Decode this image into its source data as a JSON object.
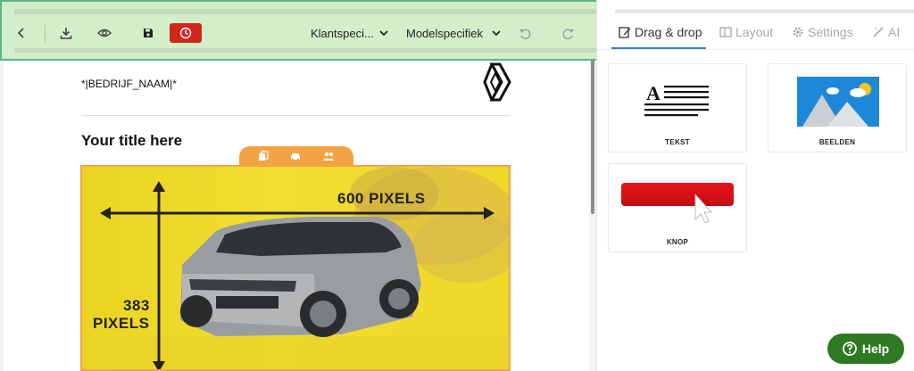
{
  "toolbar": {
    "dropdown_1": "Klantspeci...",
    "dropdown_2": "Modelspecifiek"
  },
  "email": {
    "company_name": "*|BEDRIJF_NAAM|*",
    "title": "Your title here",
    "hero": {
      "width_label": "600 PIXELS",
      "height_label_1": "383",
      "height_label_2": "PIXELS"
    }
  },
  "panel": {
    "tabs": [
      {
        "label": "Drag & drop",
        "icon": "edit-icon",
        "active": true
      },
      {
        "label": "Layout",
        "icon": "layout-icon",
        "active": false
      },
      {
        "label": "Settings",
        "icon": "gear-icon",
        "active": false
      },
      {
        "label": "AI",
        "icon": "magic-wand-icon",
        "active": false
      }
    ],
    "blocks": [
      {
        "label": "TEKST",
        "icon": "text-block-icon"
      },
      {
        "label": "BEELDEN",
        "icon": "image-block-icon"
      },
      {
        "label": "KNOP",
        "icon": "button-block-icon"
      }
    ],
    "help_label": "Help"
  },
  "colors": {
    "toolbar_bg": "#d3efc9",
    "toolbar_border": "#5bb38a",
    "red_button": "#d0261b",
    "orange_accent": "#f2a444",
    "hero_yellow": "#f0d72c",
    "tab_underline": "#3d7fc8",
    "help_green": "#2e7a22"
  }
}
